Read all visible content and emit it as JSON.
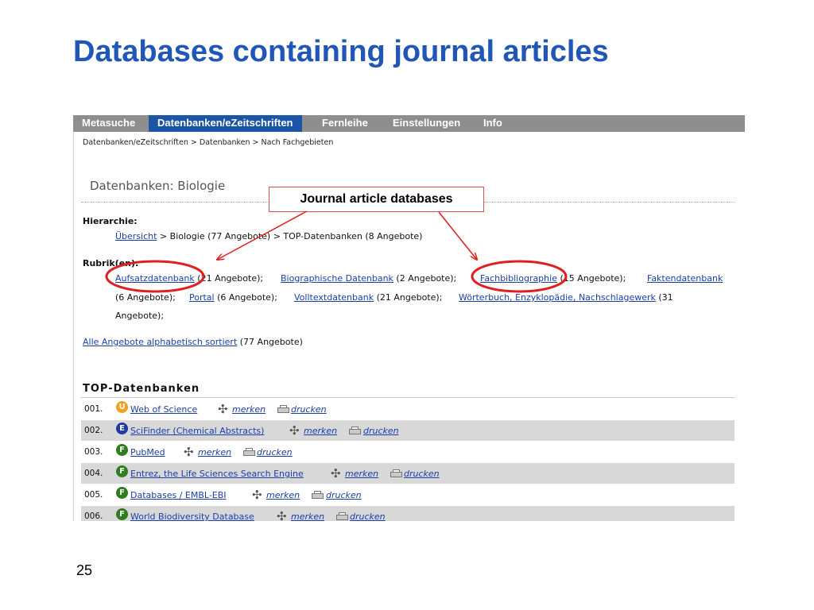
{
  "slide": {
    "title": "Databases containing journal articles",
    "number": "25",
    "callout": "Journal article databases"
  },
  "nav": {
    "tabs": [
      {
        "label": "Metasuche",
        "active": false
      },
      {
        "label": "Datenbanken/eZeitschriften",
        "active": true
      },
      {
        "label": "Fernleihe",
        "active": false
      },
      {
        "label": "Einstellungen",
        "active": false
      },
      {
        "label": "Info",
        "active": false
      }
    ]
  },
  "breadcrumb": "Datenbanken/eZeitschriften > Datenbanken > Nach Fachgebieten",
  "page": {
    "heading": "Datenbanken: Biologie",
    "hierarchie_label": "Hierarchie:",
    "hierarchie": {
      "link": "Übersicht",
      "rest": " > Biologie (77 Angebote) > TOP-Datenbanken (8 Angebote)"
    },
    "rubrik_label": "Rubrik(en):",
    "rubriken": [
      {
        "link": "Aufsatzdatenbank",
        "count": " (21 Angebote);"
      },
      {
        "link": "Biographische Datenbank",
        "count": " (2 Angebote);"
      },
      {
        "link": "Fachbibliographie",
        "count": " (15 Angebote);"
      },
      {
        "link": "Faktendatenbank",
        "count": ""
      },
      {
        "link": "Portal",
        "count": " (6 Angebote);"
      },
      {
        "link": "Volltextdatenbank",
        "count": " (21 Angebote);"
      },
      {
        "link": "Wörterbuch, Enzyklopädie, Nachschlagewerk",
        "count": " (31"
      }
    ],
    "rubrik_line2_prefix": "(6 Angebote);",
    "rubrik_line3": "Angebote);",
    "alle": {
      "link": "Alle Angebote alphabetisch sortiert",
      "count": " (77 Angebote)"
    },
    "section_title": "TOP-Datenbanken"
  },
  "actions": {
    "remember": "merken",
    "print": "drucken"
  },
  "databases": [
    {
      "num": "001.",
      "badge": "U",
      "badge_color": "#f0a020",
      "title": "Web of Science"
    },
    {
      "num": "002.",
      "badge": "E",
      "badge_color": "#1f3aa0",
      "title": "SciFinder (Chemical Abstracts)"
    },
    {
      "num": "003.",
      "badge": "F",
      "badge_color": "#2e7d1e",
      "title": "PubMed"
    },
    {
      "num": "004.",
      "badge": "F",
      "badge_color": "#2e7d1e",
      "title": "Entrez, the Life Sciences Search Engine"
    },
    {
      "num": "005.",
      "badge": "F",
      "badge_color": "#2e7d1e",
      "title": "Databases / EMBL-EBI"
    },
    {
      "num": "006.",
      "badge": "F",
      "badge_color": "#2e7d1e",
      "title": "World Biodiversity Database"
    }
  ],
  "colors": {
    "title_blue": "#1f56b8",
    "nav_active": "#1c55a6",
    "nav_bg": "#8e8e8e",
    "annotation_red": "#e02020",
    "link": "#1a3fa8"
  }
}
